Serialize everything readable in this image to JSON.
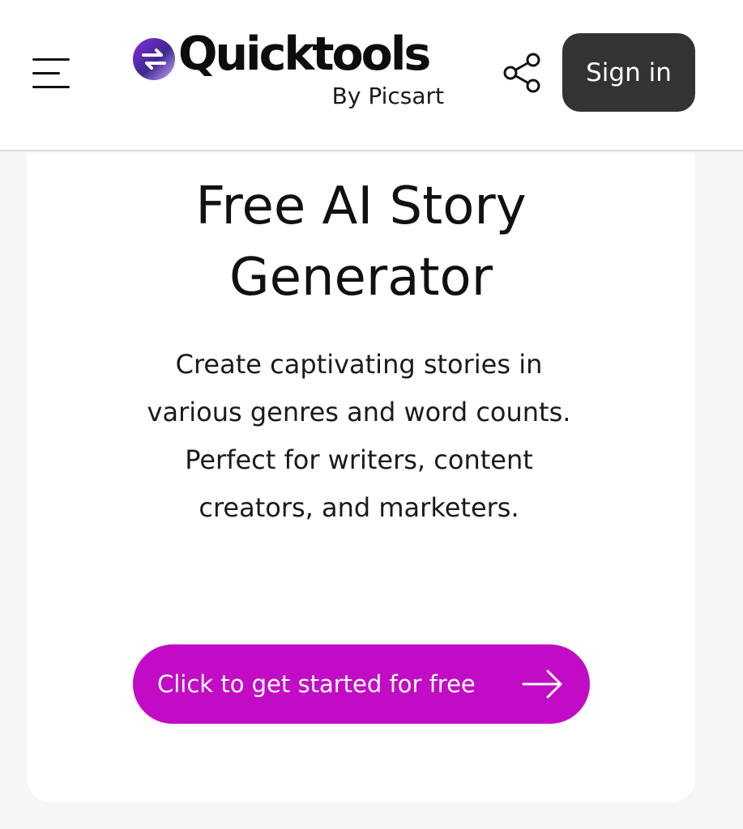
{
  "header": {
    "logo": {
      "wordmark": "Quicktools",
      "subtitle": "By Picsart"
    },
    "signin_label": "Sign in"
  },
  "hero": {
    "title_line1": "Free AI Story",
    "title_line2": "Generator",
    "description": "Create captivating stories in various genres and word counts. Perfect for writers, content creators, and marketers.",
    "cta_label": "Click to get started for free"
  },
  "colors": {
    "accent": "#c20bc5",
    "signin_bg": "#333333",
    "page_bg": "#f6f6f6"
  },
  "icons": {
    "menu": "hamburger-menu-icon",
    "logo": "quicktools-logo-icon",
    "share": "share-icon",
    "cta_arrow": "arrow-right-icon"
  }
}
